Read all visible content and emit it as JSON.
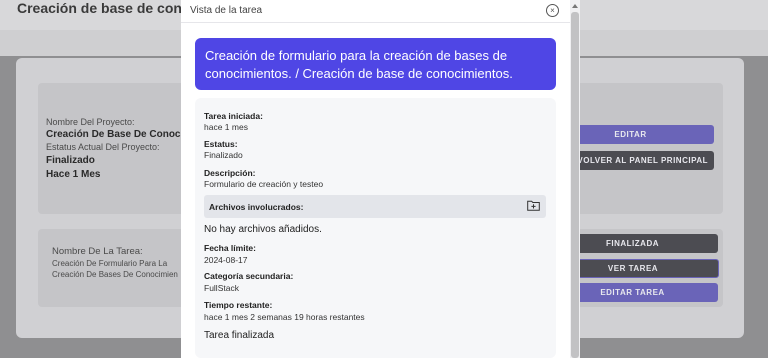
{
  "background": {
    "header_title": "Creación de base de conocimi",
    "card1": {
      "project_name_label": "Nombre Del Proyecto:",
      "project_name_value": "Creación De Base De Conocim",
      "project_status_label": "Estatus Actual Del Proyecto:",
      "project_status_value": "Finalizado",
      "project_time_value": "Hace 1 Mes"
    },
    "card2": {
      "task_name_label": "Nombre De La Tarea:",
      "task_name_line1": "Creación De Formulario Para La",
      "task_name_line2": "Creación De Bases De Conocimien"
    },
    "buttons": {
      "edit": "EDITAR",
      "back": "VOLVER AL PANEL PRINCIPAL",
      "finished": "FINALIZADA",
      "view_task": "VER TAREA",
      "edit_task": "EDITAR TAREA"
    }
  },
  "modal": {
    "title": "Vista de la tarea",
    "close_icon": "close-circle-icon",
    "banner": "Creación de formulario para la creación de bases de conocimientos. / Creación de base de conocimientos.",
    "started_label": "Tarea iniciada:",
    "started_value": "hace 1 mes",
    "status_label": "Estatus:",
    "status_value": "Finalizado",
    "description_label": "Descripción:",
    "description_value": "Formulario de creación y testeo",
    "files_label": "Archivos involucrados:",
    "files_icon": "folder-plus-icon",
    "no_files": "No hay archivos añadidos.",
    "deadline_label": "Fecha límite:",
    "deadline_value": "2024-08-17",
    "secondary_category_label": "Categoría secundaria:",
    "secondary_category_value": "FullStack",
    "remaining_label": "Tiempo restante:",
    "remaining_value": "hace 1 mes 2 semanas 19 horas restantes",
    "footer_status": "Tarea finalizada"
  },
  "colors": {
    "accent": "#4f46e5",
    "overlay": "#8f8f91"
  }
}
